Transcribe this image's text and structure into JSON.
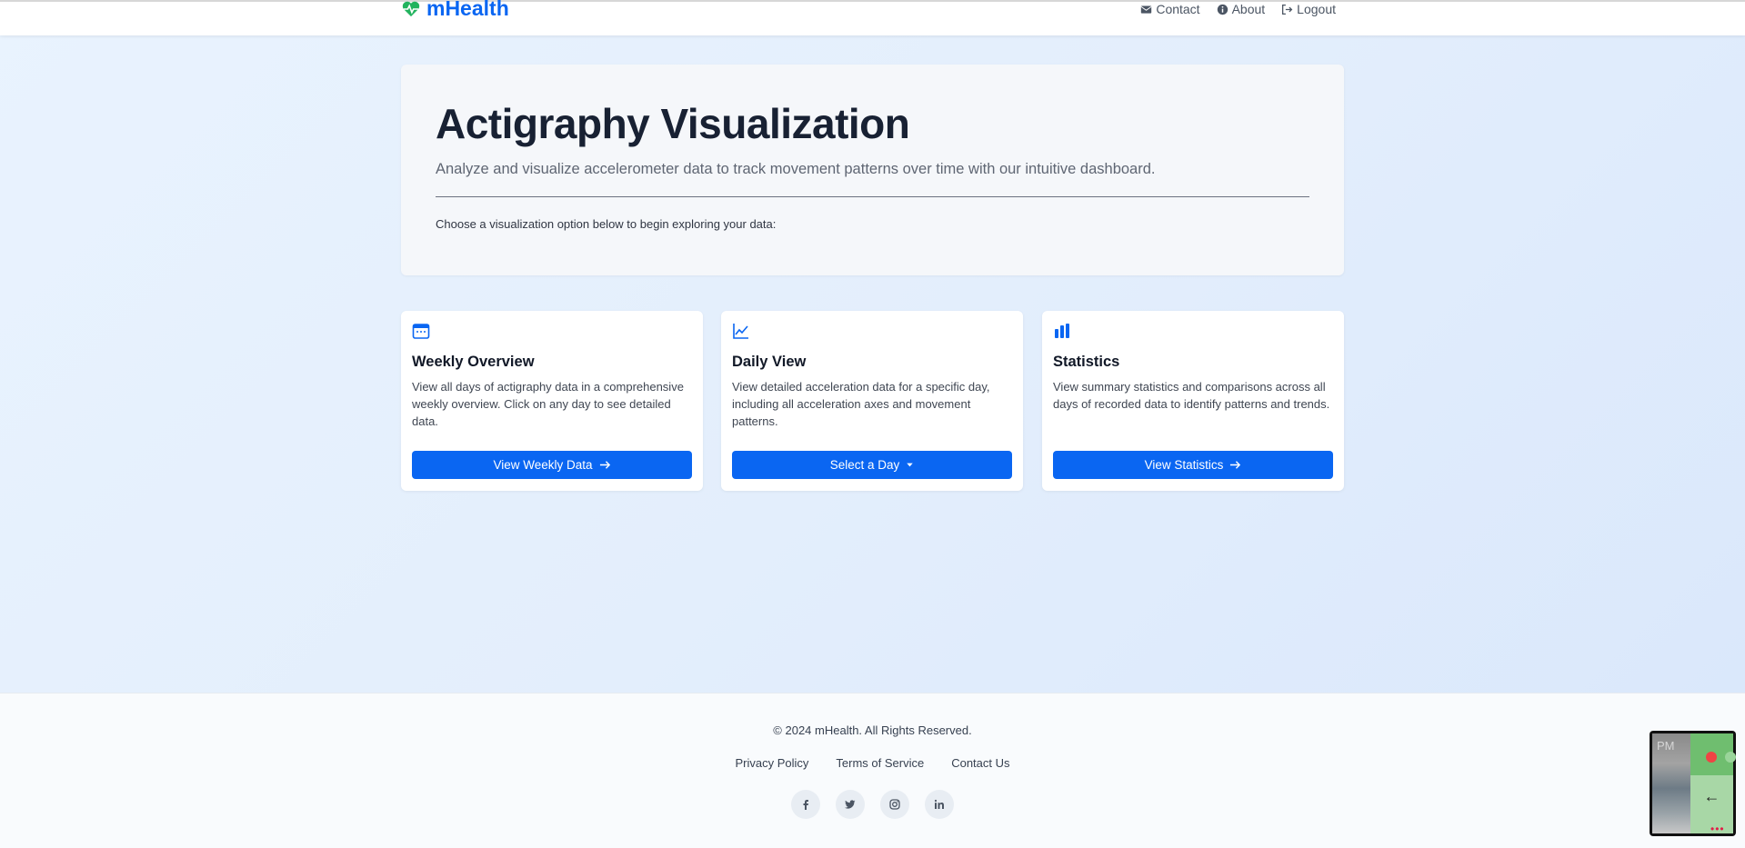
{
  "navbar": {
    "brand": "mHealth",
    "links": [
      {
        "label": "Contact",
        "icon": "envelope-icon"
      },
      {
        "label": "About",
        "icon": "info-icon"
      },
      {
        "label": "Logout",
        "icon": "logout-icon"
      }
    ]
  },
  "hero": {
    "title": "Actigraphy Visualization",
    "lead": "Analyze and visualize accelerometer data to track movement patterns over time with our intuitive dashboard.",
    "prompt": "Choose a visualization option below to begin exploring your data:"
  },
  "cards": [
    {
      "icon": "calendar-icon",
      "title": "Weekly Overview",
      "text": "View all days of actigraphy data in a comprehensive weekly overview. Click on any day to see detailed data.",
      "button": "View Weekly Data"
    },
    {
      "icon": "line-chart-icon",
      "title": "Daily View",
      "text": "View detailed acceleration data for a specific day, including all acceleration axes and movement patterns.",
      "button": "Select a Day"
    },
    {
      "icon": "bar-chart-icon",
      "title": "Statistics",
      "text": "View summary statistics and comparisons across all days of recorded data to identify patterns and trends.",
      "button": "View Statistics"
    }
  ],
  "footer": {
    "copyright": "© 2024 mHealth. All Rights Reserved.",
    "links": [
      "Privacy Policy",
      "Terms of Service",
      "Contact Us"
    ],
    "socials": [
      "facebook-icon",
      "twitter-icon",
      "instagram-icon",
      "linkedin-icon"
    ]
  },
  "widget": {
    "time_fragment": "PM"
  },
  "colors": {
    "accent": "#0a66f2",
    "hero_bg": "#f5f7fa"
  }
}
